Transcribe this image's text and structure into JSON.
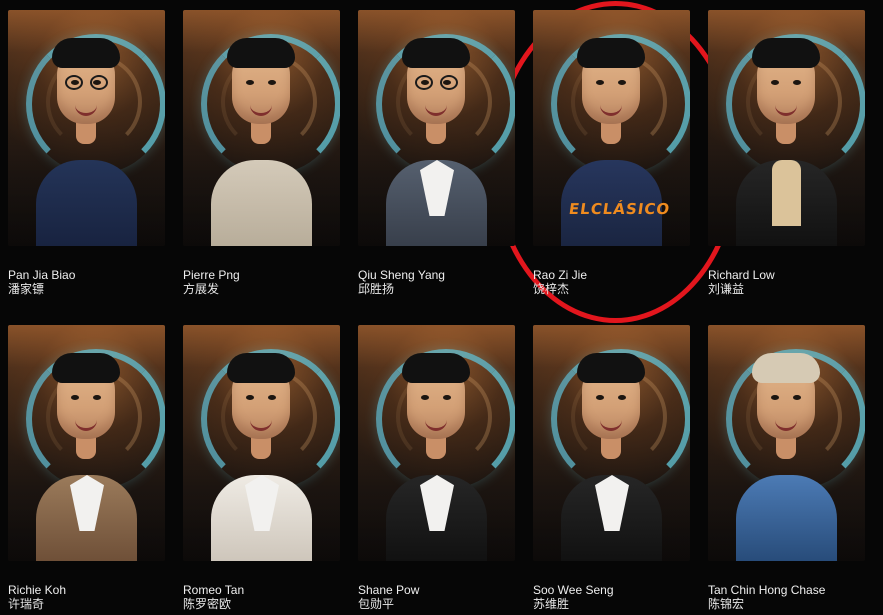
{
  "cast": [
    {
      "name": "Pan Jia Biao",
      "native_name": "潘家镖",
      "outfit": "navy",
      "glasses": true
    },
    {
      "name": "Pierre Png",
      "native_name": "方展发",
      "outfit": "beige",
      "glasses": false
    },
    {
      "name": "Qiu Sheng Yang",
      "native_name": "邱胜扬",
      "outfit": "suitgray",
      "glasses": true
    },
    {
      "name": "Rao Zi Jie",
      "native_name": "饶梓杰",
      "outfit": "sweater",
      "glasses": false,
      "shirt_text": "ELCLÁSICO",
      "highlighted": true
    },
    {
      "name": "Richard Low",
      "native_name": "刘谦益",
      "outfit": "black",
      "glasses": false,
      "turtleneck": true
    },
    {
      "name": "Richie Koh",
      "native_name": "许瑞奇",
      "outfit": "tan",
      "glasses": false
    },
    {
      "name": "Romeo Tan",
      "native_name": "陈罗密欧",
      "outfit": "cream",
      "glasses": false
    },
    {
      "name": "Shane Pow",
      "native_name": "包勋平",
      "outfit": "black",
      "glasses": false
    },
    {
      "name": "Soo Wee Seng",
      "native_name": "苏维胜",
      "outfit": "black",
      "glasses": false
    },
    {
      "name": "Tan Chin Hong Chase",
      "native_name": "陈锦宏",
      "outfit": "denim",
      "glasses": false
    }
  ],
  "colors": {
    "background": "#060606",
    "highlight_circle": "#e2161d",
    "accent_ring": "#5fc2d7"
  }
}
